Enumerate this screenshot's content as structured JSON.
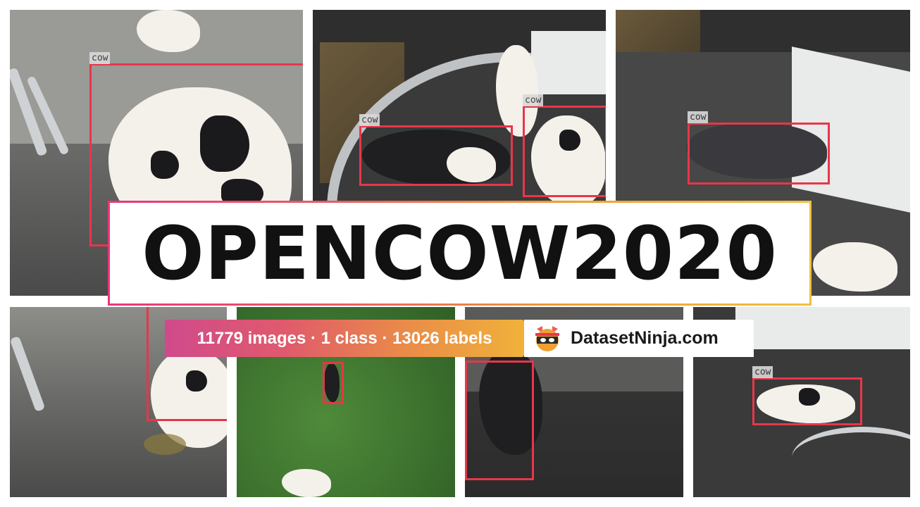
{
  "title": "OPENCOW2020",
  "stats_text": "11779 images · 1 class · 13026 labels",
  "brand": {
    "name": "DatasetNinja.com",
    "logo_icon": "ninja-logo-icon"
  },
  "annotation_class": "cow",
  "colors": {
    "bbox": "#e8364a",
    "gradient_start": "#d04a8c",
    "gradient_end": "#f0b23a"
  }
}
